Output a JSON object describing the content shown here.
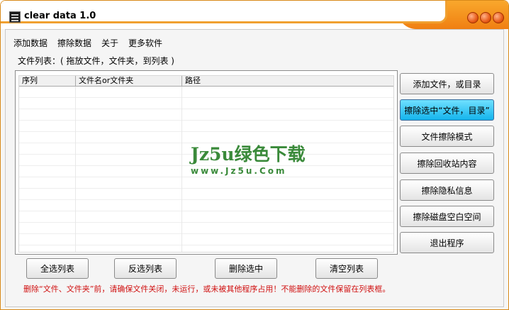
{
  "window": {
    "title": "clear data 1.0"
  },
  "menu": [
    "添加数据",
    "擦除数据",
    "关于",
    "更多软件"
  ],
  "hint": "文件列表：( 拖放文件，文件夹，到列表 )",
  "list": {
    "columns": [
      "序列",
      "文件名or文件夹",
      "路径"
    ]
  },
  "watermark": {
    "line1": "Jz5u绿色下载",
    "line2": "www.Jz5u.Com"
  },
  "side_buttons": [
    "添加文件，或目录",
    "擦除选中“文件，目录”",
    "文件擦除模式",
    "擦除回收站内容",
    "擦除隐私信息",
    "擦除磁盘空白空间",
    "退出程序"
  ],
  "bottom_buttons": [
    "全选列表",
    "反选列表",
    "删除选中",
    "清空列表"
  ],
  "warning": "删除“文件、文件夹”前，请确保文件关闭，未运行，或未被其他程序占用！不能删除的文件保留在列表框。",
  "colors": {
    "accent": "#f08a1a",
    "active_button": "#14b4ec",
    "warning": "#d01010",
    "watermark": "#3a8a3a"
  }
}
